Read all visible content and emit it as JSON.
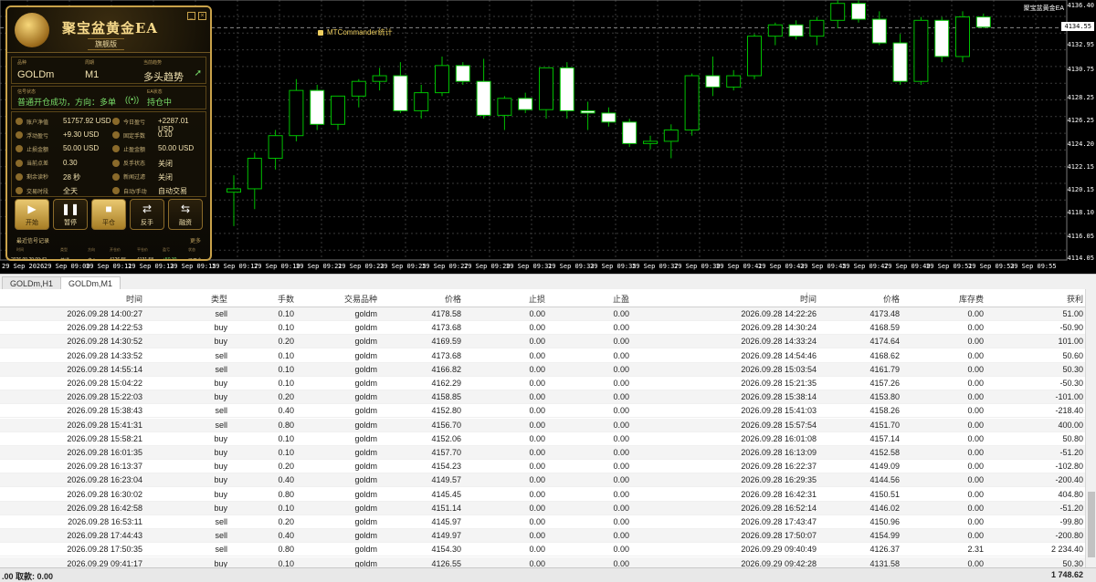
{
  "window": {
    "ea_title_top": "聚宝盆黄金EA"
  },
  "chart": {
    "indicator_label": "MTCommander统计",
    "current_price": "4134.55",
    "price_ticks": [
      "4136.40",
      "4132.95",
      "4130.75",
      "4128.25",
      "4126.25",
      "4124.20",
      "4122.15",
      "4120.15",
      "4118.10",
      "4116.05",
      "4114.05"
    ],
    "time_ticks": [
      "29 Sep 2026",
      "29 Sep 09:09",
      "29 Sep 09:11",
      "29 Sep 09:13",
      "29 Sep 09:15",
      "29 Sep 09:17",
      "29 Sep 09:19",
      "29 Sep 09:21",
      "29 Sep 09:23",
      "29 Sep 09:25",
      "29 Sep 09:27",
      "29 Sep 09:29",
      "29 Sep 09:31",
      "29 Sep 09:33",
      "29 Sep 09:35",
      "29 Sep 09:37",
      "29 Sep 09:39",
      "29 Sep 09:41",
      "29 Sep 09:43",
      "29 Sep 09:45",
      "29 Sep 09:47",
      "29 Sep 09:49",
      "29 Sep 09:51",
      "29 Sep 09:53",
      "29 Sep 09:55"
    ]
  },
  "chart_data": {
    "type": "candlestick",
    "y_range": [
      4114.0,
      4137.0
    ],
    "candles": [
      {
        "o": 4120.0,
        "h": 4121.5,
        "l": 4117.0,
        "c": 4120.3
      },
      {
        "o": 4120.3,
        "h": 4123.5,
        "l": 4118.5,
        "c": 4123.0
      },
      {
        "o": 4123.0,
        "h": 4125.5,
        "l": 4122.0,
        "c": 4125.0
      },
      {
        "o": 4125.0,
        "h": 4130.0,
        "l": 4124.5,
        "c": 4129.0
      },
      {
        "o": 4129.0,
        "h": 4129.5,
        "l": 4125.5,
        "c": 4126.0
      },
      {
        "o": 4126.0,
        "h": 4128.5,
        "l": 4125.5,
        "c": 4128.5
      },
      {
        "o": 4128.5,
        "h": 4130.0,
        "l": 4127.5,
        "c": 4129.8
      },
      {
        "o": 4129.8,
        "h": 4131.0,
        "l": 4129.0,
        "c": 4130.3
      },
      {
        "o": 4130.3,
        "h": 4131.5,
        "l": 4127.0,
        "c": 4127.2
      },
      {
        "o": 4127.2,
        "h": 4129.5,
        "l": 4126.5,
        "c": 4128.8
      },
      {
        "o": 4128.8,
        "h": 4132.0,
        "l": 4128.5,
        "c": 4131.2
      },
      {
        "o": 4131.2,
        "h": 4131.5,
        "l": 4129.5,
        "c": 4129.8
      },
      {
        "o": 4129.8,
        "h": 4131.8,
        "l": 4126.5,
        "c": 4126.8
      },
      {
        "o": 4126.8,
        "h": 4128.5,
        "l": 4125.5,
        "c": 4128.3
      },
      {
        "o": 4128.3,
        "h": 4128.8,
        "l": 4127.0,
        "c": 4127.3
      },
      {
        "o": 4127.3,
        "h": 4131.0,
        "l": 4126.5,
        "c": 4131.0
      },
      {
        "o": 4131.0,
        "h": 4131.5,
        "l": 4126.5,
        "c": 4127.2
      },
      {
        "o": 4127.2,
        "h": 4128.0,
        "l": 4125.5,
        "c": 4127.0
      },
      {
        "o": 4127.0,
        "h": 4127.5,
        "l": 4125.8,
        "c": 4126.2
      },
      {
        "o": 4126.2,
        "h": 4126.5,
        "l": 4124.0,
        "c": 4124.3
      },
      {
        "o": 4124.3,
        "h": 4125.0,
        "l": 4123.8,
        "c": 4124.5
      },
      {
        "o": 4124.5,
        "h": 4126.0,
        "l": 4123.0,
        "c": 4125.5
      },
      {
        "o": 4125.5,
        "h": 4130.5,
        "l": 4125.0,
        "c": 4130.3
      },
      {
        "o": 4130.3,
        "h": 4132.0,
        "l": 4128.5,
        "c": 4129.3
      },
      {
        "o": 4129.3,
        "h": 4130.8,
        "l": 4129.0,
        "c": 4130.3
      },
      {
        "o": 4130.3,
        "h": 4134.0,
        "l": 4130.0,
        "c": 4133.8
      },
      {
        "o": 4133.8,
        "h": 4135.0,
        "l": 4133.0,
        "c": 4134.8
      },
      {
        "o": 4134.8,
        "h": 4135.2,
        "l": 4133.5,
        "c": 4133.8
      },
      {
        "o": 4133.8,
        "h": 4135.5,
        "l": 4133.0,
        "c": 4135.2
      },
      {
        "o": 4135.2,
        "h": 4137.0,
        "l": 4134.5,
        "c": 4136.7
      },
      {
        "o": 4136.7,
        "h": 4137.0,
        "l": 4135.0,
        "c": 4135.3
      },
      {
        "o": 4135.3,
        "h": 4136.0,
        "l": 4133.0,
        "c": 4133.2
      },
      {
        "o": 4133.2,
        "h": 4134.0,
        "l": 4129.5,
        "c": 4129.8
      },
      {
        "o": 4129.8,
        "h": 4135.5,
        "l": 4129.5,
        "c": 4135.2
      },
      {
        "o": 4135.2,
        "h": 4135.5,
        "l": 4131.5,
        "c": 4132.0
      },
      {
        "o": 4132.0,
        "h": 4136.0,
        "l": 4131.5,
        "c": 4135.5
      },
      {
        "o": 4135.5,
        "h": 4135.8,
        "l": 4134.5,
        "c": 4134.6
      }
    ]
  },
  "ea": {
    "name": "聚宝盆黄金EA",
    "edition": "旗舰版",
    "symbol_cap": "品种",
    "symbol": "GOLDm",
    "period_cap": "周期",
    "period": "M1",
    "trend_cap": "当前趋势",
    "trend": "多头趋势",
    "signal_cap": "信号状态",
    "signal": "普通开仓成功，方向：多单",
    "ea_state_cap": "EA状态",
    "ea_state": "持仓中",
    "stats": [
      {
        "l1": "账户净值",
        "v1": "51757.92 USD",
        "l2": "今日盈亏",
        "v2": "+2287.01 USD",
        "g2": true
      },
      {
        "l1": "浮动盈亏",
        "v1": "+9.30 USD",
        "g1": true,
        "l2": "固定手数",
        "v2": "0.10"
      },
      {
        "l1": "止损金额",
        "v1": "50.00 USD",
        "l2": "止盈金额",
        "v2": "50.00 USD"
      },
      {
        "l1": "当前点差",
        "v1": "0.30",
        "l2": "反手状态",
        "v2": "关闭"
      },
      {
        "l1": "剩余读秒",
        "v1": "28 秒",
        "l2": "新闻过滤",
        "v2": "关闭"
      },
      {
        "l1": "交易时段",
        "v1": "全天",
        "l2": "自动/手动",
        "v2": "自动交易",
        "g2": true
      }
    ],
    "buttons": [
      {
        "icon": "▶",
        "label": "开始",
        "active": true
      },
      {
        "icon": "❚❚",
        "label": "暂停",
        "active": false
      },
      {
        "icon": "■",
        "label": "平仓",
        "active": true
      },
      {
        "icon": "⇄",
        "label": "反手",
        "active": false
      },
      {
        "icon": "⇆",
        "label": "融资",
        "active": false
      }
    ],
    "signal_record_title": "最近信号记录",
    "signal_more": "更多",
    "signal_cols": [
      "时间",
      "类型",
      "方向",
      "开仓价",
      "平仓价",
      "盈亏",
      "状态"
    ],
    "signal_vals": [
      "2026.09.29 09:42",
      "普通",
      "多入",
      "4126.55",
      "4131.58",
      "+50.30",
      "已平仓"
    ]
  },
  "tabs": [
    "GOLDm,H1",
    "GOLDm,M1"
  ],
  "table": {
    "headers": [
      "时间",
      "类型",
      "手数",
      "交易品种",
      "价格",
      "止损",
      "止盈",
      "时间",
      "价格",
      "库存费",
      "获利"
    ],
    "rows": [
      [
        "2026.09.28 14:00:27",
        "sell",
        "0.10",
        "goldm",
        "4178.58",
        "0.00",
        "0.00",
        "2026.09.28 14:22:26",
        "4173.48",
        "0.00",
        "51.00"
      ],
      [
        "2026.09.28 14:22:53",
        "buy",
        "0.10",
        "goldm",
        "4173.68",
        "0.00",
        "0.00",
        "2026.09.28 14:30:24",
        "4168.59",
        "0.00",
        "-50.90"
      ],
      [
        "2026.09.28 14:30:52",
        "buy",
        "0.20",
        "goldm",
        "4169.59",
        "0.00",
        "0.00",
        "2026.09.28 14:33:24",
        "4174.64",
        "0.00",
        "101.00"
      ],
      [
        "2026.09.28 14:33:52",
        "sell",
        "0.10",
        "goldm",
        "4173.68",
        "0.00",
        "0.00",
        "2026.09.28 14:54:46",
        "4168.62",
        "0.00",
        "50.60"
      ],
      [
        "2026.09.28 14:55:14",
        "sell",
        "0.10",
        "goldm",
        "4166.82",
        "0.00",
        "0.00",
        "2026.09.28 15:03:54",
        "4161.79",
        "0.00",
        "50.30"
      ],
      [
        "2026.09.28 15:04:22",
        "buy",
        "0.10",
        "goldm",
        "4162.29",
        "0.00",
        "0.00",
        "2026.09.28 15:21:35",
        "4157.26",
        "0.00",
        "-50.30"
      ],
      [
        "2026.09.28 15:22:03",
        "buy",
        "0.20",
        "goldm",
        "4158.85",
        "0.00",
        "0.00",
        "2026.09.28 15:38:14",
        "4153.80",
        "0.00",
        "-101.00"
      ],
      [
        "2026.09.28 15:38:43",
        "sell",
        "0.40",
        "goldm",
        "4152.80",
        "0.00",
        "0.00",
        "2026.09.28 15:41:03",
        "4158.26",
        "0.00",
        "-218.40"
      ],
      [
        "2026.09.28 15:41:31",
        "sell",
        "0.80",
        "goldm",
        "4156.70",
        "0.00",
        "0.00",
        "2026.09.28 15:57:54",
        "4151.70",
        "0.00",
        "400.00"
      ],
      [
        "2026.09.28 15:58:21",
        "buy",
        "0.10",
        "goldm",
        "4152.06",
        "0.00",
        "0.00",
        "2026.09.28 16:01:08",
        "4157.14",
        "0.00",
        "50.80"
      ],
      [
        "2026.09.28 16:01:35",
        "buy",
        "0.10",
        "goldm",
        "4157.70",
        "0.00",
        "0.00",
        "2026.09.28 16:13:09",
        "4152.58",
        "0.00",
        "-51.20"
      ],
      [
        "2026.09.28 16:13:37",
        "buy",
        "0.20",
        "goldm",
        "4154.23",
        "0.00",
        "0.00",
        "2026.09.28 16:22:37",
        "4149.09",
        "0.00",
        "-102.80"
      ],
      [
        "2026.09.28 16:23:04",
        "buy",
        "0.40",
        "goldm",
        "4149.57",
        "0.00",
        "0.00",
        "2026.09.28 16:29:35",
        "4144.56",
        "0.00",
        "-200.40"
      ],
      [
        "2026.09.28 16:30:02",
        "buy",
        "0.80",
        "goldm",
        "4145.45",
        "0.00",
        "0.00",
        "2026.09.28 16:42:31",
        "4150.51",
        "0.00",
        "404.80"
      ],
      [
        "2026.09.28 16:42:58",
        "buy",
        "0.10",
        "goldm",
        "4151.14",
        "0.00",
        "0.00",
        "2026.09.28 16:52:14",
        "4146.02",
        "0.00",
        "-51.20"
      ],
      [
        "2026.09.28 16:53:11",
        "sell",
        "0.20",
        "goldm",
        "4145.97",
        "0.00",
        "0.00",
        "2026.09.28 17:43:47",
        "4150.96",
        "0.00",
        "-99.80"
      ],
      [
        "2026.09.28 17:44:43",
        "sell",
        "0.40",
        "goldm",
        "4149.97",
        "0.00",
        "0.00",
        "2026.09.28 17:50:07",
        "4154.99",
        "0.00",
        "-200.80"
      ],
      [
        "2026.09.28 17:50:35",
        "sell",
        "0.80",
        "goldm",
        "4154.30",
        "0.00",
        "0.00",
        "2026.09.29 09:40:49",
        "4126.37",
        "2.31",
        "2 234.40"
      ],
      [
        "2026.09.29 09:41:17",
        "buy",
        "0.10",
        "goldm",
        "4126.55",
        "0.00",
        "0.00",
        "2026.09.29 09:42:28",
        "4131.58",
        "0.00",
        "50.30"
      ]
    ]
  },
  "status": {
    "left": ".00 取款: 0.00",
    "right": "1 748.62"
  }
}
